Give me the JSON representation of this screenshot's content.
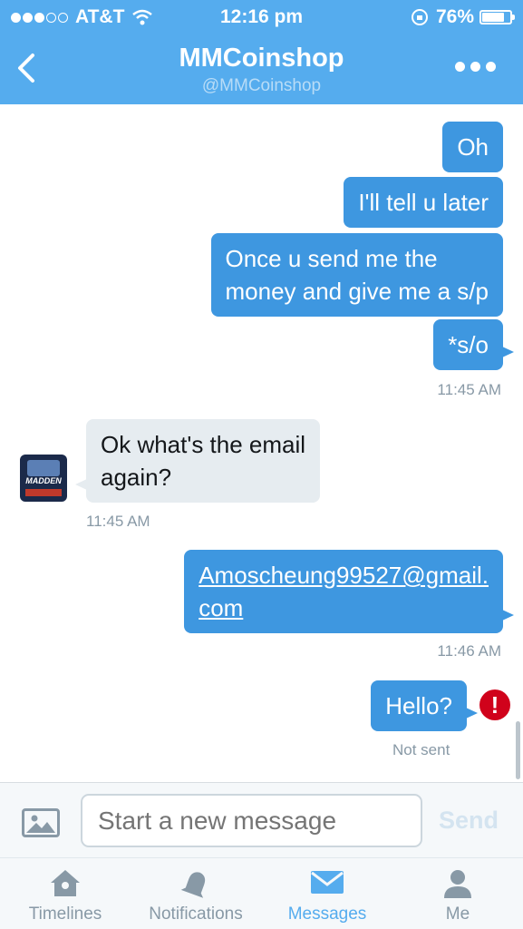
{
  "status_bar": {
    "carrier": "AT&T",
    "time": "12:16 pm",
    "battery": "76%",
    "battery_level": 0.76
  },
  "header": {
    "title": "MMCoinshop",
    "handle": "@MMCoinshop"
  },
  "messages": {
    "m1": "Oh",
    "m2": "I'll tell u later",
    "m3_line1": "Once u send me the",
    "m3_line2": "money and give me a s/p",
    "m4": "*s/o",
    "ts1": "11:45 AM",
    "m5_line1": "Ok what's the email",
    "m5_line2": "again?",
    "ts2": "11:45 AM",
    "m6_line1": "Amoscheung99527@gmail.",
    "m6_line2": "com",
    "ts3": "11:46 AM",
    "m7": "Hello?",
    "not_sent": "Not sent"
  },
  "avatar_text": "MADDEN",
  "composer": {
    "placeholder": "Start a new message",
    "send": "Send"
  },
  "tabs": {
    "timelines": "Timelines",
    "notifications": "Notifications",
    "messages": "Messages",
    "me": "Me",
    "active": "Messages"
  },
  "colors": {
    "accent": "#55acee",
    "outgoing": "#3e97e0",
    "incoming": "#e6ecf0",
    "error": "#d0021b"
  }
}
